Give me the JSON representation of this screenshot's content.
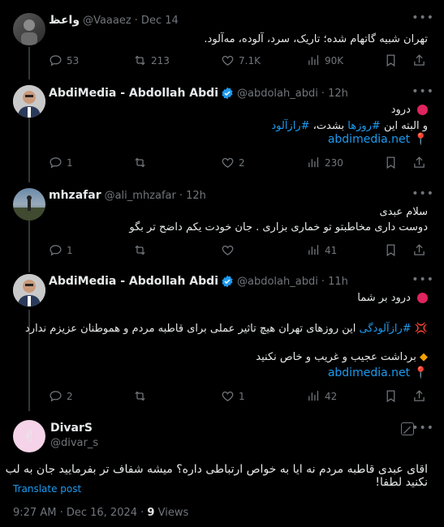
{
  "tweets": [
    {
      "display_name": "واعظ",
      "handle": "@Vaaaez",
      "time": "· Dec 14",
      "text": "تهران شبیه گاتهام شده؛ تاریک، سرد، آلوده، مه‌آلود.",
      "replies": "53",
      "retweets": "213",
      "likes": "7.1K",
      "views": "90K"
    },
    {
      "display_name": "AbdiMedia - Abdollah Abdi",
      "handle": "@abdolah_abdi",
      "time": "· 12h",
      "line1": "درود",
      "line2_prefix": "و البته این",
      "line2_tag": "#روزها",
      "line2_mid": "بشدت،",
      "line2_tag2": "#رازآلود",
      "link": "abdimedia.net",
      "replies": "1",
      "retweets": "",
      "likes": "2",
      "views": "230"
    },
    {
      "display_name": "mhzafar",
      "handle": "@ali_mhzafar",
      "time": "· 12h",
      "line1": "سلام عبدی",
      "line2": "دوست داری مخاطبتو تو خماری بزاری . جان خودت یکم داضح تر بگو",
      "replies": "1",
      "retweets": "",
      "likes": "",
      "views": "41"
    },
    {
      "display_name": "AbdiMedia - Abdollah Abdi",
      "handle": "@abdolah_abdi",
      "time": "· 11h",
      "line1": "درود بر شما",
      "line2_tag": "#رازآلودگی",
      "line2_text": "این روزهای تهران هیچ تاثیر عملی برای قاطبه مردم و هموطنان عزیزم ندارد",
      "line3": "برداشت عجیب و غریب و خاص نکنید",
      "link": "abdimedia.net",
      "replies": "2",
      "retweets": "",
      "likes": "1",
      "views": "42"
    }
  ],
  "main_tweet": {
    "display_name": "DivarS",
    "handle": "@divar_s",
    "text": "اقای عبدی قاطبه مردم نه ایا به خواص ارتباطی داره؟ میشه شفاف تر بفرمایید جان به لب نکنید لطفا!",
    "translate": "Translate post",
    "timestamp": "9:27 AM · Dec 16, 2024 ·",
    "views_count": "9",
    "views_label": "Views"
  },
  "colors": {
    "background": "#000000",
    "text": "#e7e9ea",
    "muted": "#71767b",
    "link": "#1d9bf0",
    "divider": "#2f3336"
  }
}
